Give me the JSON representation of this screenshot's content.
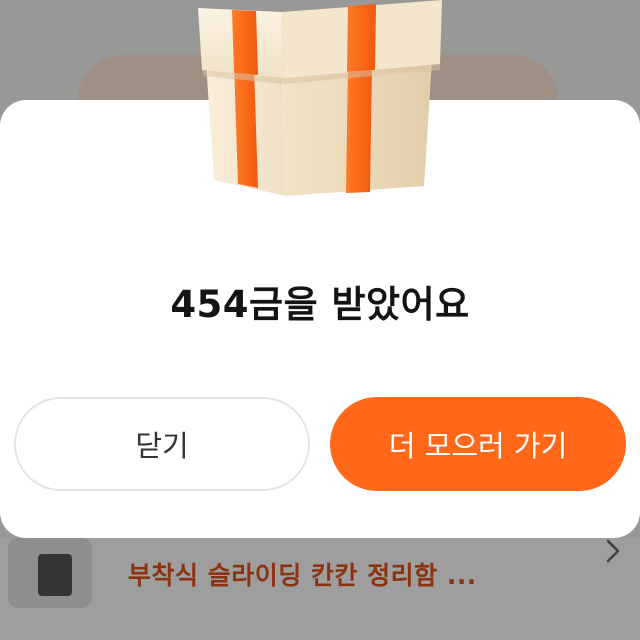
{
  "background": {
    "product_title": "부착식 슬라이딩 칸칸 정리함 ..."
  },
  "modal": {
    "title": "454금을 받았어요",
    "close_label": "닫기",
    "more_label": "더 모으러 가기"
  },
  "colors": {
    "accent": "#fe6818",
    "product_title": "#e2541c",
    "title_text": "#141414"
  },
  "icons": {
    "gift": "gift-box-icon",
    "chevron": "chevron-right-icon"
  }
}
